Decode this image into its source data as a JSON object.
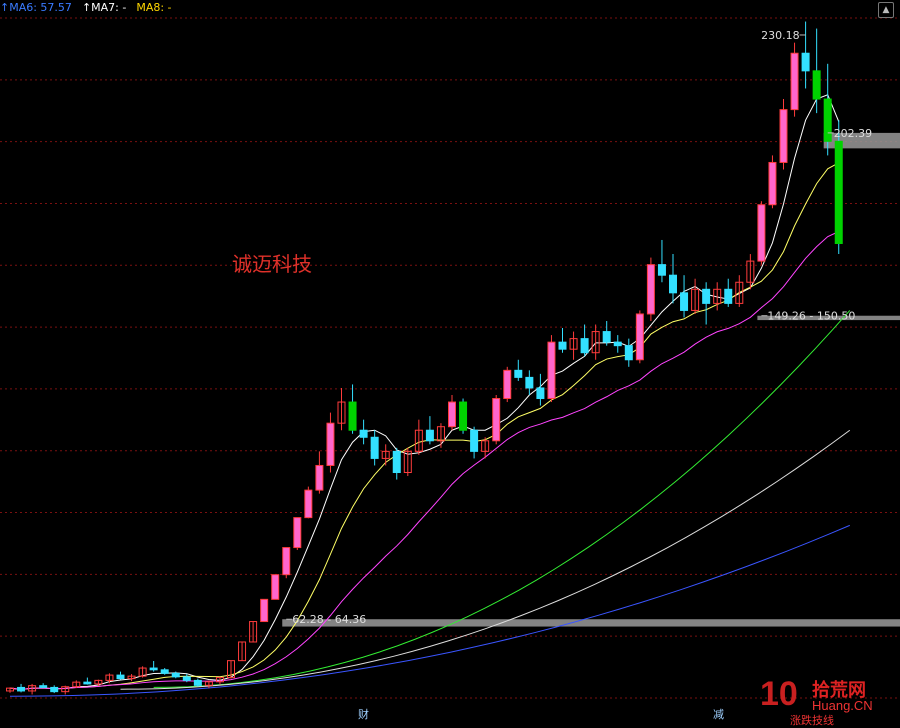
{
  "stock_name": "诚迈科技",
  "legend": [
    {
      "label": "MA6: 57.57",
      "color": "#3a7bff",
      "arrow": true
    },
    {
      "label": "MA7: -",
      "color": "#ffffff",
      "arrow": true
    },
    {
      "label": "MA8: -",
      "color": "#ffd700",
      "arrow": false
    }
  ],
  "bottom_markers": [
    "财",
    "减"
  ],
  "watermark": {
    "num": "10",
    "cn": "拾荒网",
    "en": "Huang.CN",
    "sub": "涨跌技线"
  },
  "chart_data": {
    "type": "candlestick",
    "y_range": [
      42,
      235
    ],
    "price_labels": [
      {
        "text": "230.18",
        "value": 230.18,
        "index": 72
      },
      {
        "text": "202.39",
        "value": 202.39,
        "index": 74
      },
      {
        "text": "149.26 - 150.50",
        "value": 150.5,
        "index": 68
      },
      {
        "text": "62.28 - 64.36",
        "value": 64.36,
        "index": 25
      }
    ],
    "gap_zones": [
      [
        149.26,
        150.5
      ],
      [
        62.28,
        64.36
      ],
      [
        198,
        202.39
      ]
    ],
    "colors": {
      "up": "#ff3c3c",
      "up_fill": "#ff66cc",
      "down": "#33e0ff",
      "down_fill": "#00d200"
    },
    "candles": [
      [
        44,
        45,
        43.5,
        44.8
      ],
      [
        45,
        46,
        43.6,
        44
      ],
      [
        44,
        46,
        43,
        45.5
      ],
      [
        45.5,
        46.2,
        44.8,
        45
      ],
      [
        45,
        45.6,
        43.4,
        43.8
      ],
      [
        43.8,
        45.5,
        43,
        45.2
      ],
      [
        45.2,
        47,
        44.8,
        46.5
      ],
      [
        46.5,
        47.8,
        45.8,
        46
      ],
      [
        46,
        47.2,
        45.4,
        47
      ],
      [
        47,
        49,
        46.2,
        48.5
      ],
      [
        48.5,
        49.5,
        47.2,
        47.5
      ],
      [
        47.5,
        48.8,
        46.8,
        48.2
      ],
      [
        48.2,
        51,
        47.8,
        50.5
      ],
      [
        50.5,
        52.5,
        49.5,
        50
      ],
      [
        50,
        50.5,
        48.6,
        49
      ],
      [
        49,
        49.5,
        47.6,
        48
      ],
      [
        48,
        48.8,
        46.5,
        47
      ],
      [
        47,
        47.5,
        45.2,
        45.6
      ],
      [
        45.6,
        47,
        44.8,
        46.6
      ],
      [
        46.6,
        48,
        45.8,
        47.8
      ],
      [
        47.8,
        52.6,
        47.5,
        52.6
      ],
      [
        52.6,
        57.9,
        52.6,
        57.9
      ],
      [
        57.9,
        63.7,
        57.9,
        63.7
      ],
      [
        63.7,
        70,
        63.7,
        70
      ],
      [
        70,
        77,
        70,
        77
      ],
      [
        77,
        84.7,
        76,
        84.7
      ],
      [
        84.7,
        93.2,
        84,
        93.2
      ],
      [
        93.2,
        102,
        93,
        101
      ],
      [
        101,
        112,
        100,
        108
      ],
      [
        108,
        123,
        106,
        120
      ],
      [
        120,
        130,
        118,
        126
      ],
      [
        126,
        131,
        117,
        118
      ],
      [
        118,
        121,
        114,
        116
      ],
      [
        116,
        118,
        108,
        110
      ],
      [
        110,
        114,
        108,
        112
      ],
      [
        112,
        113,
        104,
        106
      ],
      [
        106,
        113,
        105,
        112
      ],
      [
        112,
        121,
        111,
        118
      ],
      [
        118,
        122,
        114,
        115
      ],
      [
        115,
        120,
        113,
        119
      ],
      [
        119,
        128,
        118,
        126
      ],
      [
        126,
        127,
        117,
        118
      ],
      [
        118,
        119,
        110,
        112
      ],
      [
        112,
        116,
        110,
        115
      ],
      [
        115,
        128,
        114,
        127
      ],
      [
        127,
        136,
        126,
        135
      ],
      [
        135,
        138,
        132,
        133
      ],
      [
        133,
        135,
        128,
        130
      ],
      [
        130,
        134,
        125,
        127
      ],
      [
        127,
        145,
        126,
        143
      ],
      [
        143,
        147,
        140,
        141
      ],
      [
        141,
        146,
        138,
        144
      ],
      [
        144,
        148,
        139,
        140
      ],
      [
        140,
        148,
        138,
        146
      ],
      [
        146,
        149,
        142,
        143
      ],
      [
        143,
        145,
        140,
        142
      ],
      [
        142,
        144,
        136,
        138
      ],
      [
        138,
        152,
        137,
        151
      ],
      [
        151,
        167,
        149,
        165
      ],
      [
        165,
        172,
        160,
        162
      ],
      [
        162,
        168,
        154,
        157
      ],
      [
        157,
        162,
        150,
        152
      ],
      [
        152,
        161,
        151,
        158
      ],
      [
        158,
        160,
        148,
        154
      ],
      [
        154,
        160,
        152,
        158
      ],
      [
        158,
        161,
        153,
        154
      ],
      [
        154,
        162,
        153,
        160
      ],
      [
        160,
        168,
        158,
        166
      ],
      [
        166,
        183,
        165,
        182
      ],
      [
        182,
        196,
        181,
        194
      ],
      [
        194,
        212,
        192,
        209
      ],
      [
        209,
        228,
        207,
        225
      ],
      [
        225,
        234,
        215,
        220
      ],
      [
        220,
        232,
        208,
        212
      ],
      [
        212,
        222,
        196,
        200
      ],
      [
        200,
        206,
        168,
        171
      ]
    ],
    "ma_lines": [
      {
        "name": "MA5",
        "color": "#ffffff",
        "period": 5
      },
      {
        "name": "MA10",
        "color": "#ffff66",
        "period": 10
      },
      {
        "name": "MA20",
        "color": "#ff44ff",
        "period": 20
      },
      {
        "name": "MA60",
        "color": "#33ee33",
        "start": [
          13,
          45
        ],
        "end": [
          76,
          152
        ]
      },
      {
        "name": "MA120",
        "color": "#dddddd",
        "start": [
          10,
          44.5
        ],
        "end": [
          76,
          118
        ]
      },
      {
        "name": "MA250",
        "color": "#3a55ff",
        "start": [
          0,
          42.5
        ],
        "end": [
          76,
          91
        ]
      }
    ]
  }
}
